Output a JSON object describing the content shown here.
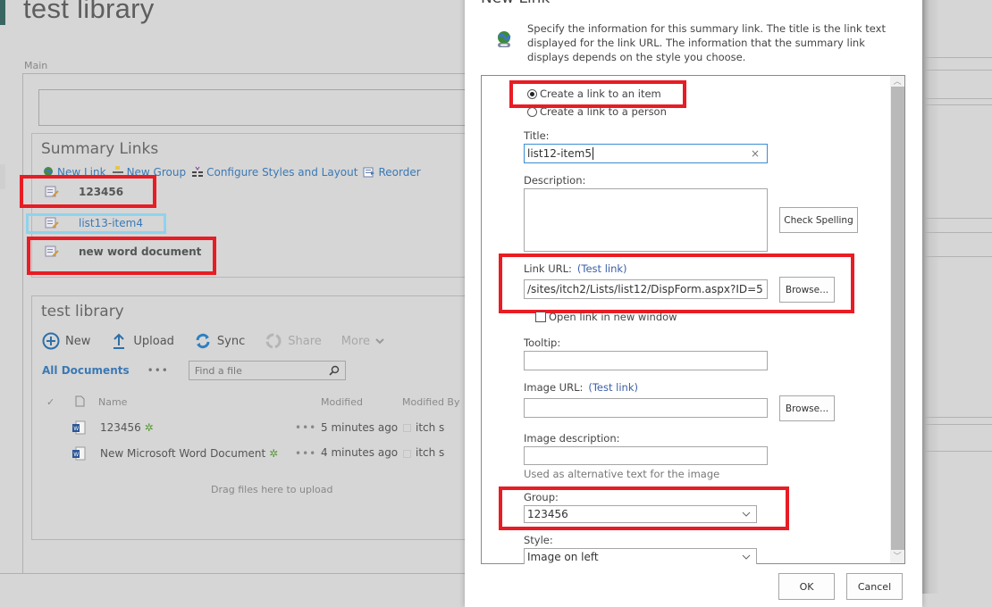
{
  "page": {
    "title": "test library",
    "zone_label": "Main"
  },
  "summary_links": {
    "title": "Summary Links",
    "toolbar": [
      {
        "label": "New Link",
        "icon": "globe-link-icon"
      },
      {
        "label": "New Group",
        "icon": "new-group-icon"
      },
      {
        "label": "Configure Styles and Layout",
        "icon": "configure-styles-icon"
      },
      {
        "label": "Reorder",
        "icon": "reorder-icon"
      }
    ],
    "items": [
      {
        "label": "123456",
        "type": "group",
        "highlight": "red"
      },
      {
        "label": "list13-item4",
        "type": "link",
        "highlight": "blue"
      },
      {
        "label": "new word document",
        "type": "group",
        "highlight": "red"
      }
    ]
  },
  "library": {
    "title": "test library",
    "commands": [
      {
        "label": "New",
        "icon": "plus-circle-icon",
        "enabled": true
      },
      {
        "label": "Upload",
        "icon": "upload-arrow-icon",
        "enabled": true
      },
      {
        "label": "Sync",
        "icon": "sync-icon",
        "enabled": true
      },
      {
        "label": "Share",
        "icon": "share-icon",
        "enabled": false
      },
      {
        "label": "More",
        "icon": "chevron-down-icon",
        "enabled": false
      }
    ],
    "view_label": "All Documents",
    "view_more": "•••",
    "search_placeholder": "Find a file",
    "columns": {
      "name": "Name",
      "modified": "Modified",
      "modified_by": "Modified By"
    },
    "files": [
      {
        "name": "123456",
        "new_marker": "✲",
        "dots": "•••",
        "modified": "5 minutes ago",
        "modified_by": "itch s"
      },
      {
        "name": "New Microsoft Word Document",
        "new_marker": "✲",
        "dots": "•••",
        "modified": "4 minutes ago",
        "modified_by": "itch s"
      }
    ],
    "drag_hint": "Drag files here to upload"
  },
  "dialog": {
    "title": "New Link",
    "intro": "Specify the information for this summary link. The title is the link text displayed for the link URL. The information that the summary link displays depends on the style you choose.",
    "radio_options": [
      {
        "label": "Create a link to an item",
        "checked": true
      },
      {
        "label": "Create a link to a person",
        "checked": false
      }
    ],
    "title_label": "Title:",
    "title_value": "list12-item5",
    "clear_glyph": "×",
    "description_label": "Description:",
    "description_value": "",
    "check_spelling": "Check Spelling",
    "link_url_label": "Link URL:",
    "test_link": "(Test link)",
    "link_url_value": "/sites/itch2/Lists/list12/DispForm.aspx?ID=5",
    "browse": "Browse...",
    "open_new_window": "Open link in new window",
    "open_new_window_checked": false,
    "tooltip_label": "Tooltip:",
    "tooltip_value": "",
    "image_url_label": "Image URL:",
    "image_url_value": "",
    "image_desc_label": "Image description:",
    "image_desc_value": "",
    "image_desc_hint": "Used as alternative text for the image",
    "group_label": "Group:",
    "group_value": "123456",
    "style_label": "Style:",
    "style_value": "Image on left",
    "ok": "OK",
    "cancel": "Cancel"
  },
  "colors": {
    "annotation_red": "#e81c24",
    "annotation_blue": "#8fd3ec",
    "link_blue": "#3b79b5",
    "overlay_gray": "#d6d6d6"
  }
}
